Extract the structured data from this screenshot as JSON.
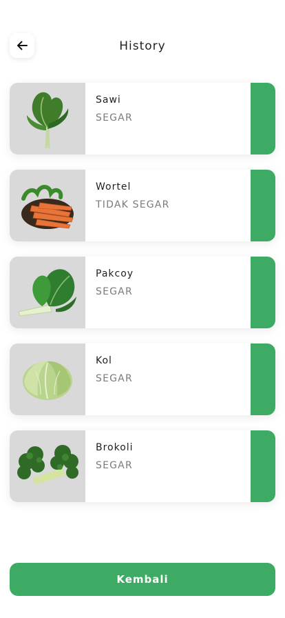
{
  "header": {
    "title": "History",
    "back_icon": "arrow-left-icon"
  },
  "history": [
    {
      "name": "Sawi",
      "status": "SEGAR",
      "image_icon": "mustard-greens-image"
    },
    {
      "name": "Wortel",
      "status": "TIDAK SEGAR",
      "image_icon": "carrot-image"
    },
    {
      "name": "Pakcoy",
      "status": "SEGAR",
      "image_icon": "bok-choy-image"
    },
    {
      "name": "Kol",
      "status": "SEGAR",
      "image_icon": "cabbage-image"
    },
    {
      "name": "Brokoli",
      "status": "SEGAR",
      "image_icon": "broccoli-image"
    }
  ],
  "footer": {
    "button_label": "Kembali"
  },
  "colors": {
    "accent": "#3dab63",
    "thumb_bg": "#d9d9d9",
    "status_text": "#7b7b7b"
  }
}
